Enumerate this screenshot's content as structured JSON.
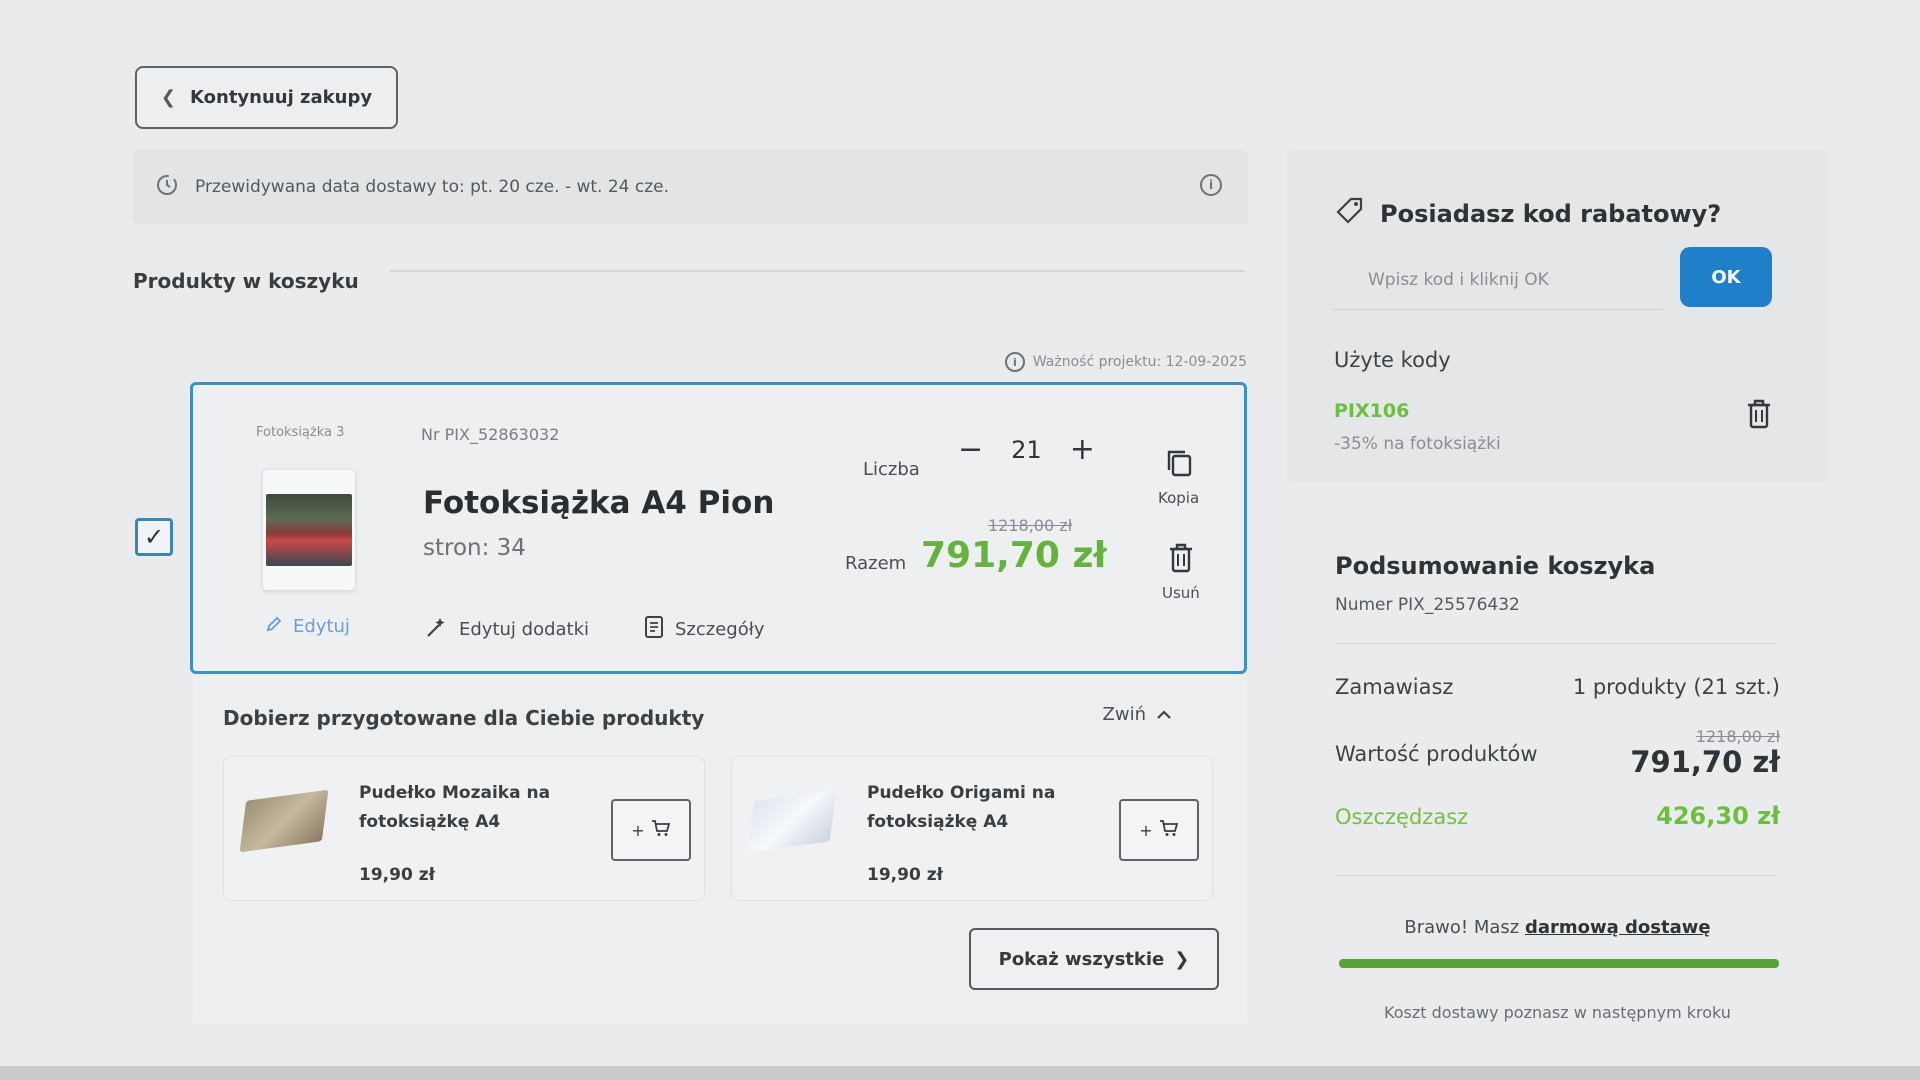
{
  "nav": {
    "back_label": "Kontynuuj zakupy"
  },
  "delivery": {
    "text": "Przewidywana data dostawy to: pt. 20 cze. - wt. 24 cze."
  },
  "cart": {
    "section_title": "Produkty w koszyku",
    "validity": "Ważność projektu: 12-09-2025",
    "item": {
      "category": "Fotoksiążka 3",
      "number": "Nr PIX_52863032",
      "title": "Fotoksiążka A4 Pion",
      "pages": "stron: 34",
      "quantity_label": "Liczba",
      "quantity": "21",
      "old_price": "1218,00 zł",
      "total_label": "Razem",
      "price": "791,70 zł",
      "copy_label": "Kopia",
      "delete_label": "Usuń",
      "edit_label": "Edytuj",
      "edit_addons_label": "Edytuj dodatki",
      "details_label": "Szczegóły"
    }
  },
  "recommendations": {
    "title": "Dobierz przygotowane dla Ciebie produkty",
    "collapse_label": "Zwiń",
    "items": [
      {
        "name": "Pudełko Mozaika na fotoksiążkę A4",
        "price": "19,90 zł"
      },
      {
        "name": "Pudełko Origami na fotoksiążkę A4",
        "price": "19,90 zł"
      }
    ],
    "show_all_label": "Pokaż wszystkie"
  },
  "discount": {
    "title": "Posiadasz kod rabatowy?",
    "placeholder": "Wpisz kod i kliknij OK",
    "ok_label": "OK",
    "used_label": "Użyte kody",
    "code": "PIX106",
    "code_desc": "-35% na fotoksiążki"
  },
  "summary": {
    "title": "Podsumowanie koszyka",
    "number": "Numer PIX_25576432",
    "order_label": "Zamawiasz",
    "order_value": "1 produkty (21 szt.)",
    "products_value_label": "Wartość produktów",
    "old_total": "1218,00 zł",
    "total": "791,70 zł",
    "savings_label": "Oszczędzasz",
    "savings": "426,30 zł",
    "free_shipping_prefix": "Brawo! Masz",
    "free_shipping_link": "darmową dostawę",
    "free_shipping_progress": 1.0,
    "shipping_note": "Koszt dostawy poznasz w następnym kroku"
  },
  "colors": {
    "accent": "#1f7fc8",
    "price_green": "#63b33c",
    "card_border": "#3d8fc6"
  }
}
